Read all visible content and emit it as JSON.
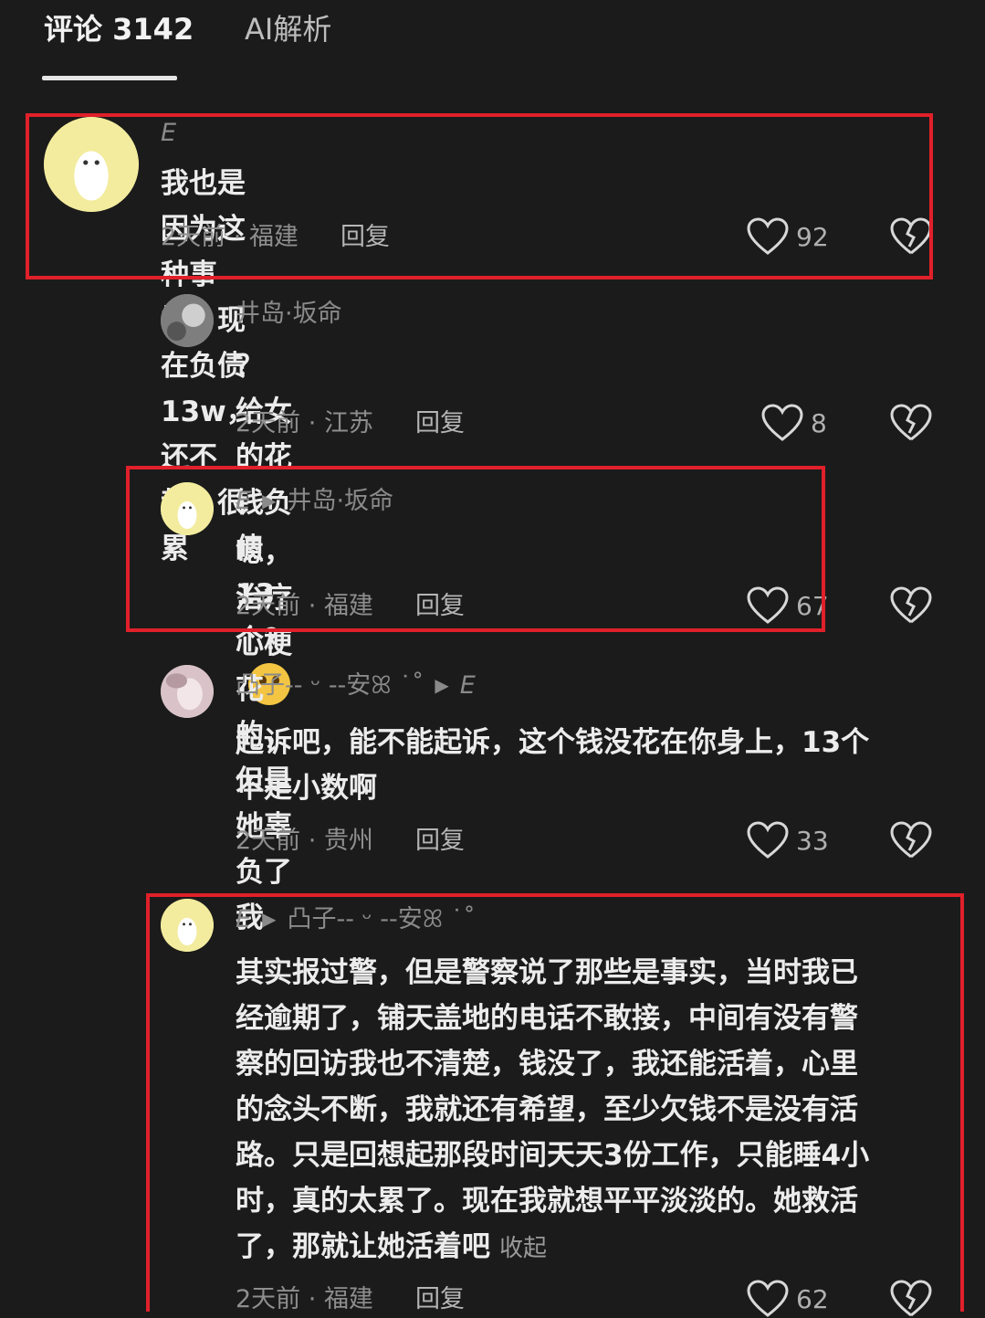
{
  "tabs": {
    "comments_label": "评论 3142",
    "ai_label": "AI解析"
  },
  "comments": [
    {
      "author": "E",
      "text": "我也是因为这种事情，现在负债13w，还不起，很累",
      "time": "2天前",
      "location": "福建",
      "reply_label": "回复",
      "likes": "92"
    },
    {
      "author": "井岛·坂命",
      "text": "？ 给女的花钱负债13个？",
      "time": "2天前",
      "location": "江苏",
      "reply_label": "回复",
      "likes": "8"
    },
    {
      "author": "E",
      "reply_to": "井岛·坂命",
      "text": "嗯，治疗心梗花的，但是她辜负了我",
      "time": "2天前",
      "location": "福建",
      "reply_label": "回复",
      "likes": "67"
    },
    {
      "author": "凸子-- ᵕ --安ꕤ ˙˚",
      "reply_to": "E",
      "text_line1": "起诉吧，能不能起诉，这个钱没花在你身上，13个",
      "text_line2": "不是小数啊",
      "time": "2天前",
      "location": "贵州",
      "reply_label": "回复",
      "likes": "33"
    },
    {
      "author": "E",
      "reply_to": "凸子-- ᵕ --安ꕤ ˙˚",
      "lines": [
        "其实报过警，但是警察说了那些是事实，当时我已",
        "经逾期了，铺天盖地的电话不敢接，中间有没有警",
        "察的回访我也不清楚，钱没了，我还能活着，心里",
        "的念头不断，我就还有希望，至少欠钱不是没有活",
        "路。只是回想起那段时间天天3份工作，只能睡4小",
        "时，真的太累了。现在我就想平平淡淡的。她救活",
        "了，那就让她活着吧"
      ],
      "collapse_label": "收起",
      "time": "2天前",
      "location": "福建",
      "reply_label": "回复",
      "likes": "62"
    }
  ],
  "meta_separator": " · ",
  "colors": {
    "background": "#1b1b1b",
    "highlight_box": "#e0202a"
  }
}
